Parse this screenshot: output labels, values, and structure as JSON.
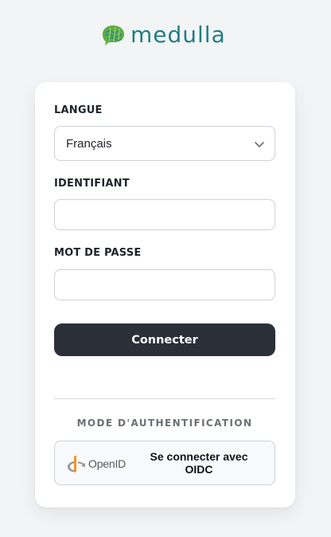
{
  "brand": {
    "name": "medulla",
    "color": "#1f7e86",
    "icon": "brain-icon"
  },
  "form": {
    "language_label": "LANGUE",
    "language_value": "Français",
    "username_label": "IDENTIFIANT",
    "username_value": "",
    "password_label": "MOT DE PASSE",
    "password_value": "",
    "submit_label": "Connecter"
  },
  "auth": {
    "mode_label": "MODE D'AUTHENTIFICATION",
    "provider_logo_text": "OpenID",
    "provider_button_label": "Se connecter avec OIDC"
  },
  "colors": {
    "primary_button": "#2b3038",
    "background": "#f3f4f6",
    "openid_orange": "#f7931e"
  }
}
